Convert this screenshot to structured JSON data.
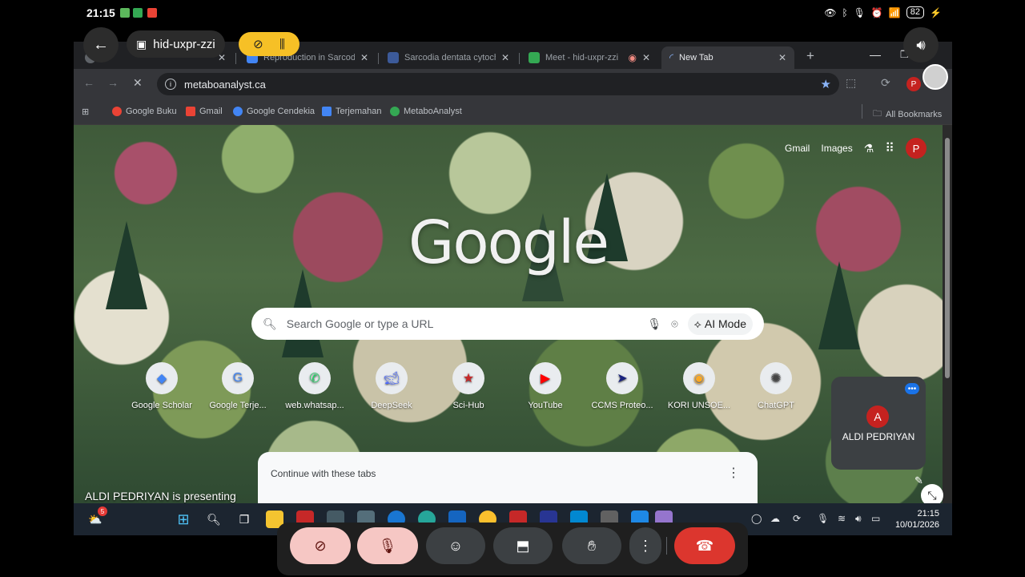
{
  "status_bar": {
    "time": "21:15",
    "battery": "82"
  },
  "meet": {
    "meeting_code": "hid-uxpr-zzi",
    "presenting_text": "ALDI PEDRIYAN is presenting",
    "participant": {
      "initial": "A",
      "name": "ALDI PEDRIYAN"
    }
  },
  "browser": {
    "tabs": [
      {
        "label": "M",
        "active": false,
        "fav_color": "#5f6368"
      },
      {
        "label": "Reproduction in Sarcodia",
        "active": false,
        "fav_color": "#4285f4"
      },
      {
        "label": "Sarcodia dentata cytoch",
        "active": false,
        "fav_color": "#3c5a99"
      },
      {
        "label": "Meet - hid-uxpr-zzi",
        "active": false,
        "fav_color": "#34a853"
      },
      {
        "label": "New Tab",
        "active": true,
        "fav_color": "#8ab4f8"
      }
    ],
    "new_tab_symbol": "+",
    "url": "metaboanalyst.ca",
    "bookmarks": [
      {
        "label": "Google Buku",
        "color": "#ea4335"
      },
      {
        "label": "Gmail",
        "color": "#ea4335"
      },
      {
        "label": "Google Cendekia",
        "color": "#4285f4"
      },
      {
        "label": "Terjemahan",
        "color": "#4285f4"
      },
      {
        "label": "MetaboAnalyst",
        "color": "#34a853"
      }
    ],
    "all_bookmarks": "All Bookmarks",
    "profile_initial": "P"
  },
  "newtab": {
    "top_links": {
      "gmail": "Gmail",
      "images": "Images"
    },
    "logo": "Google",
    "search_placeholder": "Search Google or type a URL",
    "ai_mode": "AI Mode",
    "shortcuts": [
      {
        "label": "Google Scholar",
        "icon": "scholar-icon",
        "color": "#4285f4"
      },
      {
        "label": "Google Terje...",
        "icon": "translate-icon",
        "color": "#4285f4"
      },
      {
        "label": "web.whatsap...",
        "icon": "whatsapp-icon",
        "color": "#25d366"
      },
      {
        "label": "DeepSeek",
        "icon": "deepseek-icon",
        "color": "#4d6bfe"
      },
      {
        "label": "Sci-Hub",
        "icon": "scihub-icon",
        "color": "#c62828"
      },
      {
        "label": "YouTube",
        "icon": "youtube-icon",
        "color": "#ff0000"
      },
      {
        "label": "CCMS Proteo...",
        "icon": "ccms-icon",
        "color": "#1a237e"
      },
      {
        "label": "KORI UNSOE...",
        "icon": "kori-icon",
        "color": "#f9a825"
      },
      {
        "label": "ChatGPT",
        "icon": "chatgpt-icon",
        "color": "#444444"
      }
    ],
    "continue_title": "Continue with these tabs"
  },
  "taskbar": {
    "time": "21:15",
    "date": "10/01/2026",
    "weather_badge": "5"
  }
}
